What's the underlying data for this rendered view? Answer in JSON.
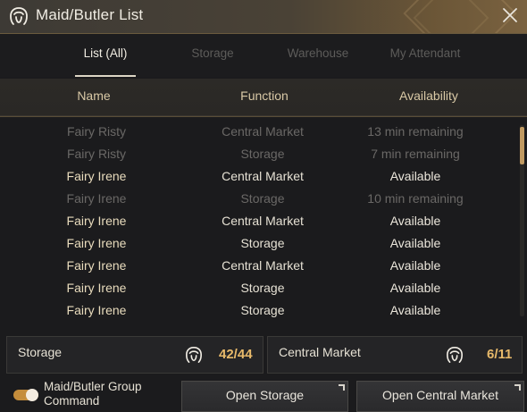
{
  "window": {
    "title": "Maid/Butler List"
  },
  "tabs": [
    {
      "label": "List (All)",
      "active": true
    },
    {
      "label": "Storage",
      "active": false
    },
    {
      "label": "Warehouse",
      "active": false
    },
    {
      "label": "My Attendant",
      "active": false
    }
  ],
  "columns": {
    "name": "Name",
    "function": "Function",
    "availability": "Availability"
  },
  "rows": [
    {
      "name": "Fairy Risty",
      "function": "Central Market",
      "availability": "13 min remaining",
      "state": "dim"
    },
    {
      "name": "Fairy Risty",
      "function": "Storage",
      "availability": "7 min remaining",
      "state": "dim"
    },
    {
      "name": "Fairy Irene",
      "function": "Central Market",
      "availability": "Available",
      "state": "avail"
    },
    {
      "name": "Fairy Irene",
      "function": "Storage",
      "availability": "10 min remaining",
      "state": "dim"
    },
    {
      "name": "Fairy Irene",
      "function": "Central Market",
      "availability": "Available",
      "state": "avail"
    },
    {
      "name": "Fairy Irene",
      "function": "Storage",
      "availability": "Available",
      "state": "avail"
    },
    {
      "name": "Fairy Irene",
      "function": "Central Market",
      "availability": "Available",
      "state": "avail"
    },
    {
      "name": "Fairy Irene",
      "function": "Storage",
      "availability": "Available",
      "state": "avail"
    },
    {
      "name": "Fairy Irene",
      "function": "Storage",
      "availability": "Available",
      "state": "avail"
    }
  ],
  "summary": {
    "storage": {
      "label": "Storage",
      "count": "42/44"
    },
    "market": {
      "label": "Central Market",
      "count": "6/11"
    }
  },
  "footer": {
    "group_label": "Maid/Butler Group Command",
    "toggle_on": true,
    "open_storage": "Open Storage",
    "open_market": "Open Central Market"
  },
  "colors": {
    "accent_gold": "#e7b96a",
    "toggle": "#c58d3b",
    "header_text": "#d9c9a6"
  },
  "icons": {
    "title": "maid-head-icon",
    "close": "close-icon",
    "summary": "maid-head-icon"
  }
}
